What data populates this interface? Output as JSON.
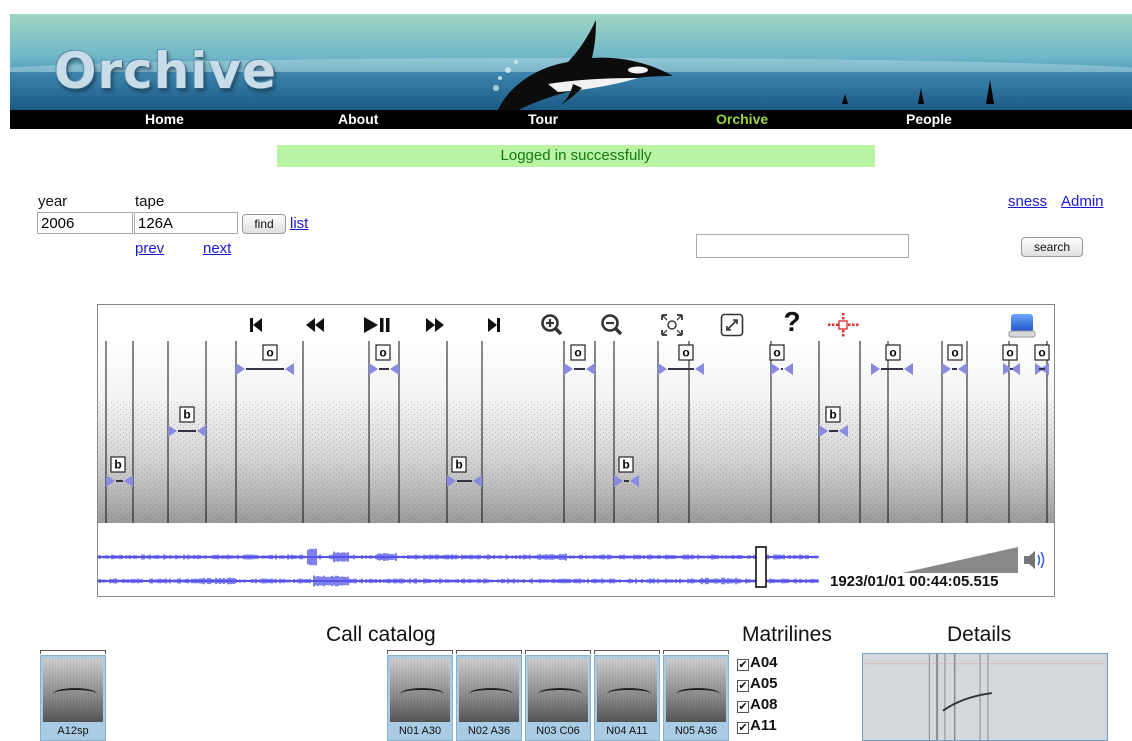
{
  "app": {
    "logo_text": "Orchive"
  },
  "nav": {
    "items": [
      {
        "label": "Home",
        "active": false
      },
      {
        "label": "About",
        "active": false
      },
      {
        "label": "Tour",
        "active": false
      },
      {
        "label": "Orchive",
        "active": true
      },
      {
        "label": "People",
        "active": false
      }
    ]
  },
  "status": {
    "message": "Logged in successfully"
  },
  "tape_selector": {
    "year_label": "year",
    "year_value": "2006",
    "tape_label": "tape",
    "tape_value": "126A",
    "find_label": "find",
    "list_link": "list",
    "prev_link": "prev",
    "next_link": "next"
  },
  "user": {
    "username": "sness",
    "admin_link": "Admin"
  },
  "search": {
    "value": "",
    "placeholder": "",
    "button_label": "search"
  },
  "toolbar": {
    "buttons": [
      {
        "name": "skip-to-start",
        "icon": "skip-start-icon"
      },
      {
        "name": "rewind",
        "icon": "rewind-icon"
      },
      {
        "name": "play-pause",
        "icon": "play-pause-icon"
      },
      {
        "name": "fast-forward",
        "icon": "fast-forward-icon"
      },
      {
        "name": "skip-to-end",
        "icon": "skip-end-icon"
      },
      {
        "name": "zoom-in",
        "icon": "zoom-in-icon"
      },
      {
        "name": "zoom-out",
        "icon": "zoom-out-icon"
      },
      {
        "name": "fit",
        "icon": "fit-icon"
      },
      {
        "name": "fullscreen",
        "icon": "fullscreen-icon"
      },
      {
        "name": "help",
        "icon": "help-icon",
        "text": "?"
      },
      {
        "name": "crosshair",
        "icon": "crosshair-icon"
      },
      {
        "name": "save",
        "icon": "save-disk-icon"
      }
    ]
  },
  "annotations": [
    {
      "label": "b"
    },
    {
      "label": "b"
    },
    {
      "label": "o"
    },
    {
      "label": "o"
    },
    {
      "label": "b"
    },
    {
      "label": "o"
    },
    {
      "label": "b"
    },
    {
      "label": "o"
    },
    {
      "label": "o"
    },
    {
      "label": "b"
    },
    {
      "label": "o"
    },
    {
      "label": "o"
    },
    {
      "label": "o"
    },
    {
      "label": "o"
    }
  ],
  "player": {
    "timestamp": "1923/01/01 00:44:05.515"
  },
  "call_catalog": {
    "title": "Call catalog",
    "left_item": {
      "label": "A12sp"
    },
    "items": [
      {
        "label": "N01 A30"
      },
      {
        "label": "N02 A36"
      },
      {
        "label": "N03 C06"
      },
      {
        "label": "N04 A11"
      },
      {
        "label": "N05 A36"
      }
    ]
  },
  "matrilines": {
    "title": "Matrilines",
    "items": [
      {
        "label": "A04",
        "checked": true
      },
      {
        "label": "A05",
        "checked": true
      },
      {
        "label": "A08",
        "checked": true
      },
      {
        "label": "A11",
        "checked": true
      }
    ]
  },
  "details": {
    "title": "Details"
  },
  "colors": {
    "nav_active": "#9bd33a",
    "status_bg": "#b9f3a3",
    "status_text": "#157a10",
    "link": "#1a1ad6",
    "waveform": "#2a2ae0",
    "annotation_marker": "#8a8ae0"
  }
}
